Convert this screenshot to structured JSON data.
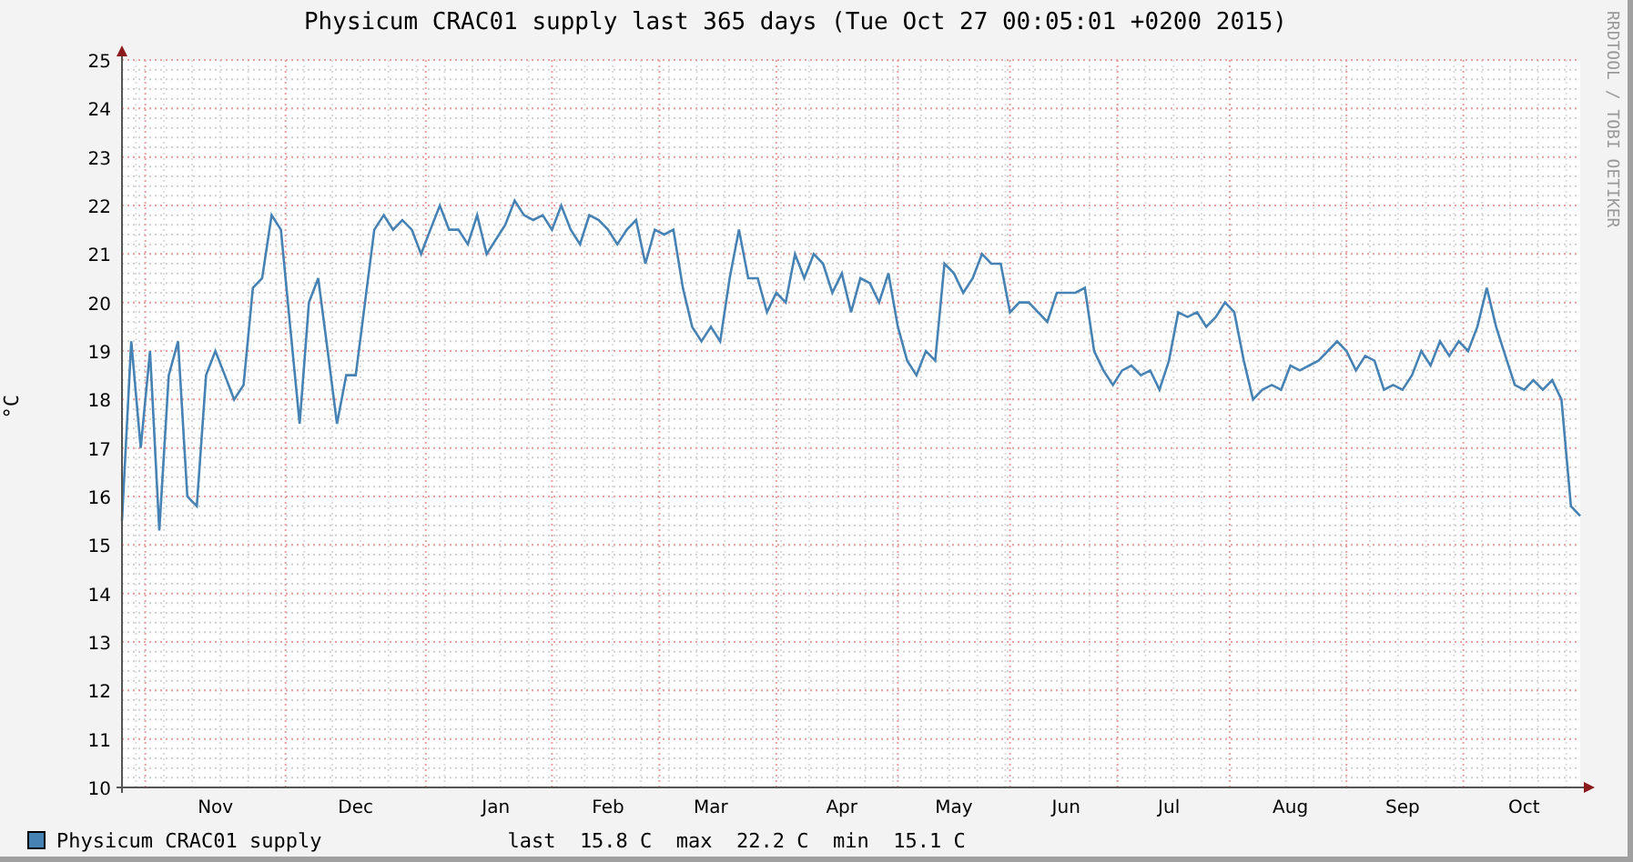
{
  "title": "Physicum CRAC01 supply last 365 days (Tue Oct 27 00:05:01 +0200 2015)",
  "watermark_side": "RRDTOOL / TOBI OETIKER",
  "chart_data": {
    "type": "line",
    "grid": true,
    "ylabel": "°C",
    "ylim": [
      10,
      25
    ],
    "yticks": [
      10,
      11,
      12,
      13,
      14,
      15,
      16,
      17,
      18,
      19,
      20,
      21,
      22,
      23,
      24,
      25
    ],
    "categories": [
      null,
      null,
      null,
      null,
      null,
      null,
      null,
      null,
      null,
      null,
      "Nov",
      null,
      null,
      null,
      null,
      null,
      null,
      null,
      null,
      null,
      null,
      null,
      null,
      null,
      null,
      "Dec",
      null,
      null,
      null,
      null,
      null,
      null,
      null,
      null,
      null,
      null,
      null,
      null,
      null,
      null,
      "Jan",
      null,
      null,
      null,
      null,
      null,
      null,
      null,
      null,
      null,
      null,
      null,
      "Feb",
      null,
      null,
      null,
      null,
      null,
      null,
      null,
      null,
      null,
      null,
      "Mar",
      null,
      null,
      null,
      null,
      null,
      null,
      null,
      null,
      null,
      null,
      null,
      null,
      null,
      "Apr",
      null,
      null,
      null,
      null,
      null,
      null,
      null,
      null,
      null,
      null,
      null,
      "May",
      null,
      null,
      null,
      null,
      null,
      null,
      null,
      null,
      null,
      null,
      null,
      "Jun",
      null,
      null,
      null,
      null,
      null,
      null,
      null,
      null,
      null,
      null,
      "Jul",
      null,
      null,
      null,
      null,
      null,
      null,
      null,
      null,
      null,
      null,
      null,
      null,
      "Aug",
      null,
      null,
      null,
      null,
      null,
      null,
      null,
      null,
      null,
      null,
      null,
      "Sep",
      null,
      null,
      null,
      null,
      null,
      null,
      null,
      null,
      null,
      null,
      null,
      null,
      "Oct",
      null,
      null,
      null,
      null,
      null,
      null
    ],
    "series": [
      {
        "name": "Physicum CRAC01 supply",
        "color": "#4682b4",
        "values": [
          15.5,
          19.2,
          17,
          19,
          15.3,
          18.5,
          19.2,
          16,
          15.8,
          18.5,
          19,
          18.5,
          18,
          18.3,
          20.3,
          20.5,
          21.8,
          21.5,
          19.5,
          17.5,
          20,
          20.5,
          19,
          17.5,
          18.5,
          18.5,
          20,
          21.5,
          21.8,
          21.5,
          21.7,
          21.5,
          21,
          21.5,
          22,
          21.5,
          21.5,
          21.2,
          21.8,
          21,
          21.3,
          21.6,
          22.1,
          21.8,
          21.7,
          21.8,
          21.5,
          22,
          21.5,
          21.2,
          21.8,
          21.7,
          21.5,
          21.2,
          21.5,
          21.7,
          20.8,
          21.5,
          21.4,
          21.5,
          20.3,
          19.5,
          19.2,
          19.5,
          19.2,
          20.5,
          21.5,
          20.5,
          20.5,
          19.8,
          20.2,
          20,
          21,
          20.5,
          21,
          20.8,
          20.2,
          20.6,
          19.8,
          20.5,
          20.4,
          20,
          20.6,
          19.5,
          18.8,
          18.5,
          19,
          18.8,
          20.8,
          20.6,
          20.2,
          20.5,
          21,
          20.8,
          20.8,
          19.8,
          20,
          20,
          19.8,
          19.6,
          20.2,
          20.2,
          20.2,
          20.3,
          19,
          18.6,
          18.3,
          18.6,
          18.7,
          18.5,
          18.6,
          18.2,
          18.8,
          19.8,
          19.7,
          19.8,
          19.5,
          19.7,
          20,
          19.8,
          18.8,
          18,
          18.2,
          18.3,
          18.2,
          18.7,
          18.6,
          18.7,
          18.8,
          19,
          19.2,
          19,
          18.6,
          18.9,
          18.8,
          18.2,
          18.3,
          18.2,
          18.5,
          19,
          18.7,
          19.2,
          18.9,
          19.2,
          19,
          19.5,
          20.3,
          19.5,
          18.9,
          18.3,
          18.2,
          18.4,
          18.2,
          18.4,
          18,
          15.8,
          15.6
        ]
      }
    ]
  },
  "legend": {
    "stats": "last  15.8 C  max  22.2 C  min  15.1 C"
  }
}
